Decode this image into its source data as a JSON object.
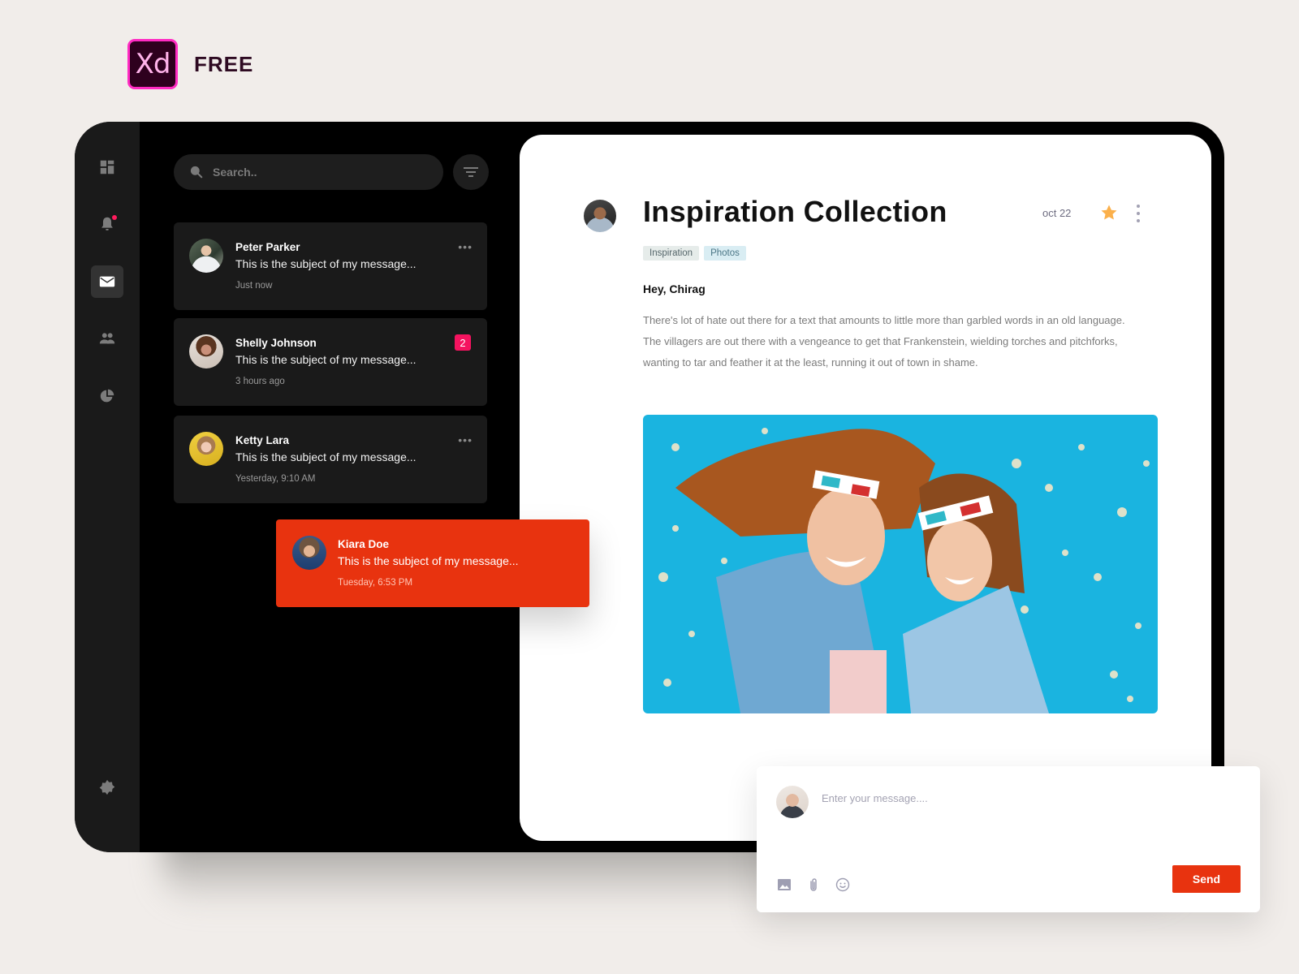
{
  "brand": {
    "logo_text": "Xd",
    "label": "FREE"
  },
  "colors": {
    "accent": "#e8330f",
    "badge": "#f5135f",
    "star": "#fbb04b",
    "rail": "#1a1a1a",
    "card": "#1a1a1a"
  },
  "sidebar": {
    "items": [
      {
        "icon": "dashboard-icon",
        "active": false
      },
      {
        "icon": "bell-icon",
        "active": false,
        "has_notification": true
      },
      {
        "icon": "mail-icon",
        "active": true
      },
      {
        "icon": "users-icon",
        "active": false
      },
      {
        "icon": "pie-chart-icon",
        "active": false
      }
    ],
    "settings_icon": "gear-icon"
  },
  "search": {
    "placeholder": "Search..",
    "value": ""
  },
  "messages": [
    {
      "name": "Peter Parker",
      "subject": "This is the subject of my message...",
      "time": "Just now",
      "badge": null
    },
    {
      "name": "Shelly Johnson",
      "subject": "This is the subject of my message...",
      "time": "3 hours ago",
      "badge": "2"
    },
    {
      "name": "Ketty Lara",
      "subject": "This is the subject of my message...",
      "time": "Yesterday, 9:10 AM",
      "badge": null
    }
  ],
  "active_message": {
    "name": "Kiara Doe",
    "subject": "This is the subject of my message...",
    "time": "Tuesday, 6:53 PM"
  },
  "detail": {
    "title": "Inspiration Collection",
    "date": "oct 22",
    "starred": true,
    "tags": [
      "Inspiration",
      "Photos"
    ],
    "greeting": "Hey, Chirag",
    "body": "There's lot of hate out there for a text that amounts to little more than garbled words in an old language. The villagers are out there with a vengeance to get that Frankenstein, wielding torches and pitchforks, wanting to tar and feather it at the least, running it out of town in shame.",
    "image_alt": "Mother and daughter laughing with 3D glasses on blue popcorn background"
  },
  "composer": {
    "placeholder": "Enter your message....",
    "value": "",
    "send_label": "Send"
  }
}
